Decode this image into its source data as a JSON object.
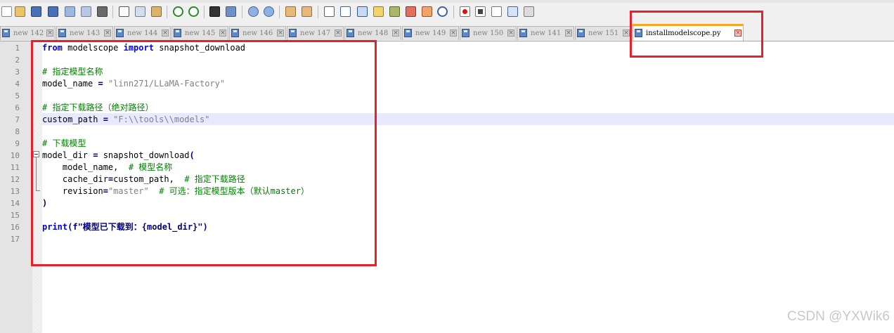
{
  "tabs": [
    {
      "label": "new 142"
    },
    {
      "label": "new 143"
    },
    {
      "label": "new 144"
    },
    {
      "label": "new 145"
    },
    {
      "label": "new 146"
    },
    {
      "label": "new 147"
    },
    {
      "label": "new 148"
    },
    {
      "label": "new 149"
    },
    {
      "label": "new 150"
    },
    {
      "label": "new 141"
    },
    {
      "label": "new 151"
    }
  ],
  "active_tab": {
    "label": "installmodelscope.py"
  },
  "tab_close_glyph": "×",
  "line_numbers": [
    "1",
    "2",
    "3",
    "4",
    "5",
    "6",
    "7",
    "8",
    "9",
    "10",
    "11",
    "12",
    "13",
    "14",
    "15",
    "16",
    "17"
  ],
  "code": {
    "l1_kw1": "from",
    "l1_mid": " modelscope ",
    "l1_kw2": "import",
    "l1_end": " snapshot_download",
    "l3_comment": "# 指定模型名称",
    "l4_ident": "model_name ",
    "l4_op": "=",
    "l4_str": " \"linn271/LLaMA-Factory\"",
    "l6_comment": "# 指定下载路径（绝对路径）",
    "l7_ident": "custom_path ",
    "l7_op": "=",
    "l7_str": " \"F:\\\\tools\\\\models\"",
    "l9_comment": "# 下载模型",
    "l10_ident": "model_dir ",
    "l10_op": "=",
    "l10_call": " snapshot_download",
    "l10_paren": "(",
    "l11_arg": "    model_name,  ",
    "l11_comment": "# 模型名称",
    "l12_arg": "    cache_dir",
    "l12_op": "=",
    "l12_val": "custom_path,  ",
    "l12_comment": "# 指定下载路径",
    "l13_arg": "    revision",
    "l13_op": "=",
    "l13_str": "\"master\"  ",
    "l13_comment": "# 可选：指定模型版本（默认master）",
    "l14_paren": ")",
    "l16_kw": "print",
    "l16_paren": "(",
    "l16_text": "f\"模型已下载到：{model_dir}\"",
    "l16_close": ")"
  },
  "watermark": "CSDN @YXWik6",
  "colors": {
    "keyword": "#0000ff",
    "comment": "#008000",
    "string": "#808080",
    "operator": "#000080",
    "annotation_red": "#e8202a",
    "active_tab_accent": "#f5a623"
  }
}
